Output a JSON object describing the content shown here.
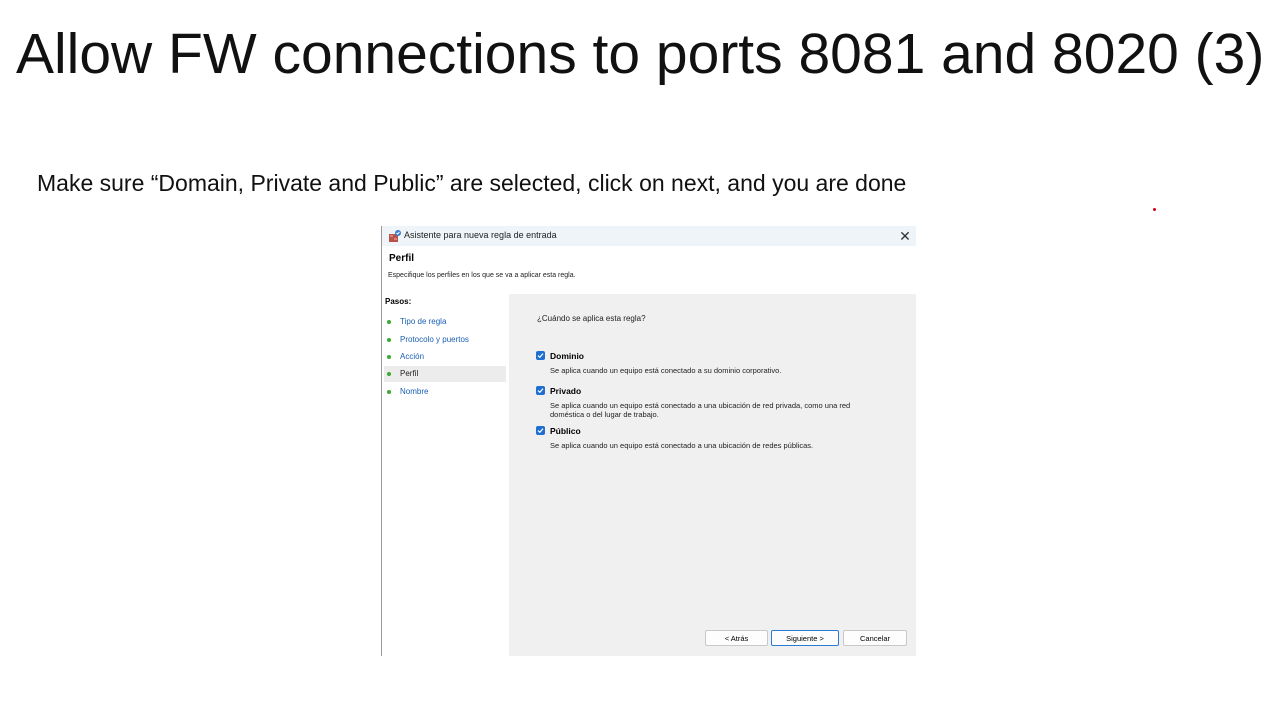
{
  "slide": {
    "title": "Allow FW connections to ports 8081 and 8020 (3)",
    "subtitle": "Make sure “Domain, Private and Public” are selected, click on next, and you are done"
  },
  "dialog": {
    "title": "Asistente para nueva regla de entrada",
    "close_glyph": "✕",
    "header_title": "Perfil",
    "header_description": "Especifique los perfiles en los que se va a aplicar esta regla.",
    "steps_heading": "Pasos:",
    "steps": [
      {
        "label": "Tipo de regla",
        "active": false
      },
      {
        "label": "Protocolo y puertos",
        "active": false
      },
      {
        "label": "Acción",
        "active": false
      },
      {
        "label": "Perfil",
        "active": true
      },
      {
        "label": "Nombre",
        "active": false
      }
    ],
    "question": "¿Cuándo se aplica esta regla?",
    "options": [
      {
        "label": "Dominio",
        "checked": true,
        "description": "Se aplica cuando un equipo está conectado a su dominio corporativo."
      },
      {
        "label": "Privado",
        "checked": true,
        "description": "Se aplica cuando un equipo está conectado a una ubicación de red privada, como una red doméstica o del lugar de trabajo."
      },
      {
        "label": "Público",
        "checked": true,
        "description": "Se aplica cuando un equipo está conectado a una ubicación de redes públicas."
      }
    ],
    "buttons": {
      "back": "< Atrás",
      "next": "Siguiente >",
      "cancel": "Cancelar"
    }
  },
  "colors": {
    "checkbox": "#1f6fd1",
    "step_link": "#1a5fb4",
    "step_dot": "#3aaa35",
    "content_bg": "#f0f0f0"
  }
}
